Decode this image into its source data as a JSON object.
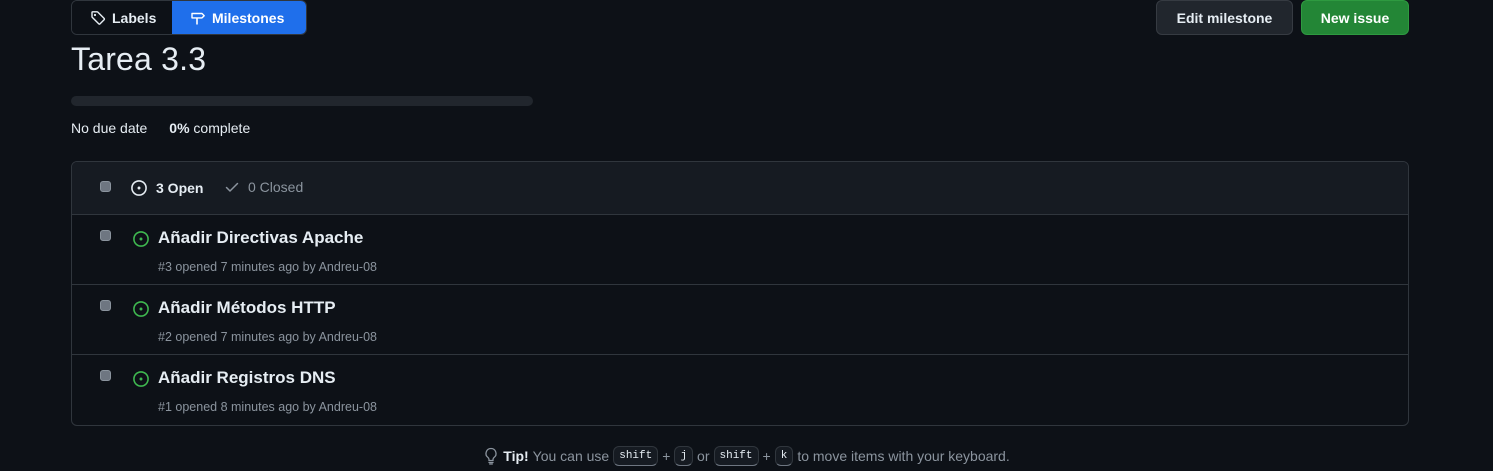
{
  "nav": {
    "labels_tab": "Labels",
    "milestones_tab": "Milestones"
  },
  "actions": {
    "edit_milestone": "Edit milestone",
    "new_issue": "New issue"
  },
  "milestone": {
    "title": "Tarea 3.3",
    "due": "No due date",
    "percent": "0%",
    "complete_label": "complete",
    "progress_fraction": 0.0
  },
  "list": {
    "open_count_label": "3 Open",
    "closed_count_label": "0 Closed",
    "issues": [
      {
        "title": "Añadir Directivas Apache",
        "number": "#3",
        "opened": "opened 7 minutes ago",
        "by": "by",
        "author": "Andreu-08"
      },
      {
        "title": "Añadir Métodos HTTP",
        "number": "#2",
        "opened": "opened 7 minutes ago",
        "by": "by",
        "author": "Andreu-08"
      },
      {
        "title": "Añadir Registros DNS",
        "number": "#1",
        "opened": "opened 8 minutes ago",
        "by": "by",
        "author": "Andreu-08"
      }
    ]
  },
  "tip": {
    "label": "Tip!",
    "text_before": "You can use",
    "key_shift": "shift",
    "plus": "+",
    "key_j": "j",
    "or": "or",
    "key_k": "k",
    "text_after": "to move items with your keyboard."
  },
  "icons": {
    "labels": "tag-icon",
    "milestones": "milestone-icon",
    "open": "issue-opened-icon",
    "closed": "check-icon",
    "tip": "light-bulb-icon"
  },
  "colors": {
    "background": "#0d1117",
    "accent_blue": "#1f6feb",
    "open_green": "#3fb950",
    "new_issue_green": "#238636"
  }
}
